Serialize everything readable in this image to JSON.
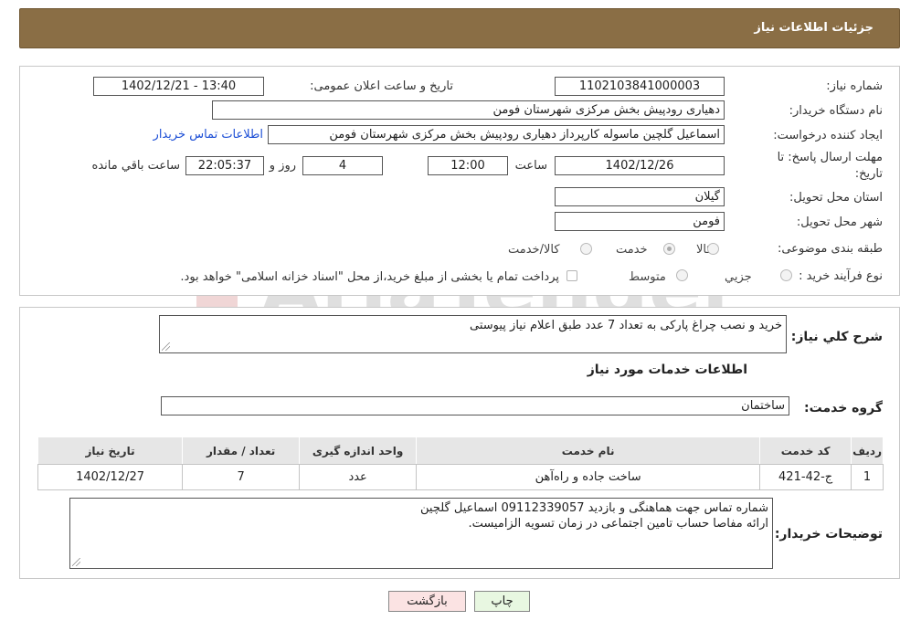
{
  "header": {
    "title": "جزئیات اطلاعات نیاز"
  },
  "form": {
    "need_number": {
      "label": "شماره نیاز:",
      "value": "1102103841000003"
    },
    "announce_datetime": {
      "label": "تاریخ و ساعت اعلان عمومی:",
      "value": "1402/12/21 - 13:40"
    },
    "buyer_org": {
      "label": "نام دستگاه خریدار:",
      "value": "دهیاری رودپیش بخش مرکزی شهرستان فومن"
    },
    "requester": {
      "label": "ایجاد کننده درخواست:",
      "value": "اسماعیل گلچین ماسوله کارپرداز دهیاری رودپیش بخش مرکزی شهرستان فومن",
      "contact_link": "اطلاعات تماس خریدار"
    },
    "deadline": {
      "label_line1": "مهلت ارسال پاسخ: تا",
      "label_line2": "تاریخ:",
      "date": "1402/12/26",
      "time_label": "ساعت",
      "time": "12:00",
      "days": "4",
      "days_label": "روز و",
      "remaining": "22:05:37",
      "remaining_label": "ساعت باقي مانده"
    },
    "province": {
      "label": "استان محل تحویل:",
      "value": "گیلان"
    },
    "city": {
      "label": "شهر محل تحویل:",
      "value": "فومن"
    },
    "category": {
      "label": "طبقه بندی موضوعی:",
      "options": [
        {
          "label": "کالا",
          "checked": false
        },
        {
          "label": "خدمت",
          "checked": true
        },
        {
          "label": "کالا/خدمت",
          "checked": false
        }
      ]
    },
    "purchase_type": {
      "label": "نوع فرآیند خرید :",
      "options": [
        {
          "label": "جزیي",
          "checked": false
        },
        {
          "label": "متوسط",
          "checked": false
        }
      ],
      "payment_note": "پرداخت تمام یا بخشی از مبلغ خرید،از محل \"اسناد خزانه اسلامی\" خواهد بود."
    }
  },
  "description": {
    "label": "شرح کلي نیاز:",
    "value": "خرید و نصب چراغ پارکی به تعداد 7 عدد طبق اعلام نیاز پیوستی"
  },
  "services": {
    "section_title": "اطلاعات خدمات مورد نیاز",
    "group_label": "گروه خدمت:",
    "group_value": "ساختمان",
    "columns": [
      "ردیف",
      "کد خدمت",
      "نام خدمت",
      "واحد اندازه گیری",
      "تعداد / مقدار",
      "تاریخ نیاز"
    ],
    "rows": [
      [
        "1",
        "ج-42-421",
        "ساخت جاده و راه‌آهن",
        "عدد",
        "7",
        "1402/12/27"
      ]
    ]
  },
  "buyer_notes": {
    "label": "توضیحات خریدار:",
    "line1": "شماره تماس جهت هماهنگی و بازدید 09112339057 اسماعیل گلچین",
    "line2": "ارائه مفاصا حساب تامین اجتماعی در زمان تسویه الزامیست."
  },
  "buttons": {
    "print": "چاپ",
    "back": "بازگشت"
  },
  "watermark": {
    "text": "AriaTender.net"
  },
  "colors": {
    "header_bg": "#8a6e45",
    "link": "#1d4fd6",
    "back_btn": "#fbe3e3",
    "print_btn": "#e8f7e1"
  }
}
